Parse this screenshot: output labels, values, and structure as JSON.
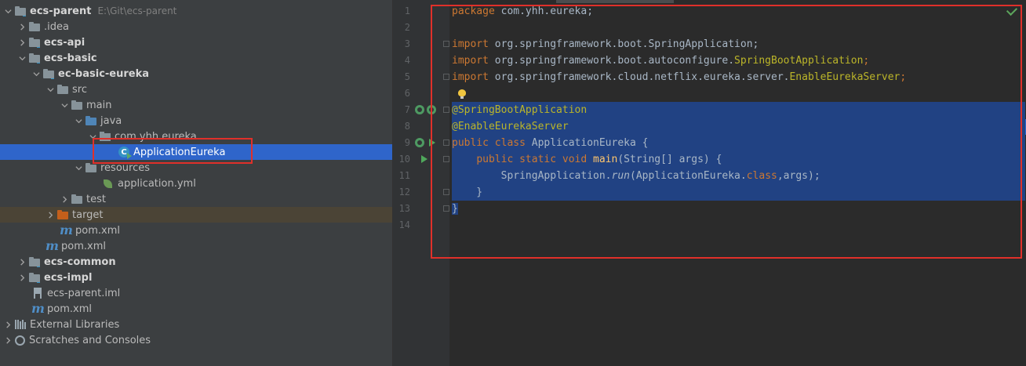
{
  "project_tree": {
    "root": {
      "name": "ecs-parent",
      "path": "E:\\Git\\ecs-parent"
    },
    "items": {
      "idea": ".idea",
      "ecs_api": "ecs-api",
      "ecs_basic": "ecs-basic",
      "ec_basic_eureka": "ec-basic-eureka",
      "src": "src",
      "main": "main",
      "java": "java",
      "package": "com.yhh.eureka",
      "class_file": "ApplicationEureka",
      "resources": "resources",
      "yml": "application.yml",
      "test": "test",
      "target": "target",
      "pom_inner": "pom.xml",
      "pom_basic": "pom.xml",
      "ecs_common": "ecs-common",
      "ecs_impl": "ecs-impl",
      "iml": "ecs-parent.iml",
      "pom_root": "pom.xml",
      "external_libraries": "External Libraries",
      "scratches": "Scratches and Consoles"
    },
    "maven_icon_glyph": "m",
    "class_icon_glyph": "C"
  },
  "editor": {
    "line_numbers": [
      "1",
      "2",
      "3",
      "4",
      "5",
      "6",
      "7",
      "8",
      "9",
      "10",
      "11",
      "12",
      "13",
      "14"
    ],
    "lines": {
      "l1_kw": "package",
      "l1_rest": " com.yhh.eureka;",
      "l3_kw": "import",
      "l3_rest": " org.springframework.boot.SpringApplication;",
      "l4_kw": "import",
      "l4_pre": " org.springframework.boot.autoconfigure.",
      "l4_ann": "SpringBootApplication",
      "l4_end": ";",
      "l5_kw": "import",
      "l5_pre": " org.springframework.cloud.netflix.eureka.server.",
      "l5_ann": "EnableEurekaServer",
      "l5_end": ";",
      "l7": "@SpringBootApplication",
      "l8": "@EnableEurekaServer",
      "l9_kw": "public class",
      "l9_rest": " ApplicationEureka {",
      "l10_indent": "    ",
      "l10_kw": "public static void",
      "l10_sp": " ",
      "l10_fn": "main",
      "l10_rest": "(String[] args) {",
      "l11_indent": "        ",
      "l11_pre": "SpringApplication.",
      "l11_it": "run",
      "l11_mid": "(ApplicationEureka.",
      "l11_kw": "class",
      "l11_end": ",args);",
      "l12": "    }",
      "l13": "}"
    }
  },
  "colors": {
    "keyword": "#cc7832",
    "annotation": "#bbb529",
    "method": "#ffc66d",
    "selection": "#214283",
    "tree_selection": "#2f65ca",
    "highlight_box": "#e0302a"
  }
}
